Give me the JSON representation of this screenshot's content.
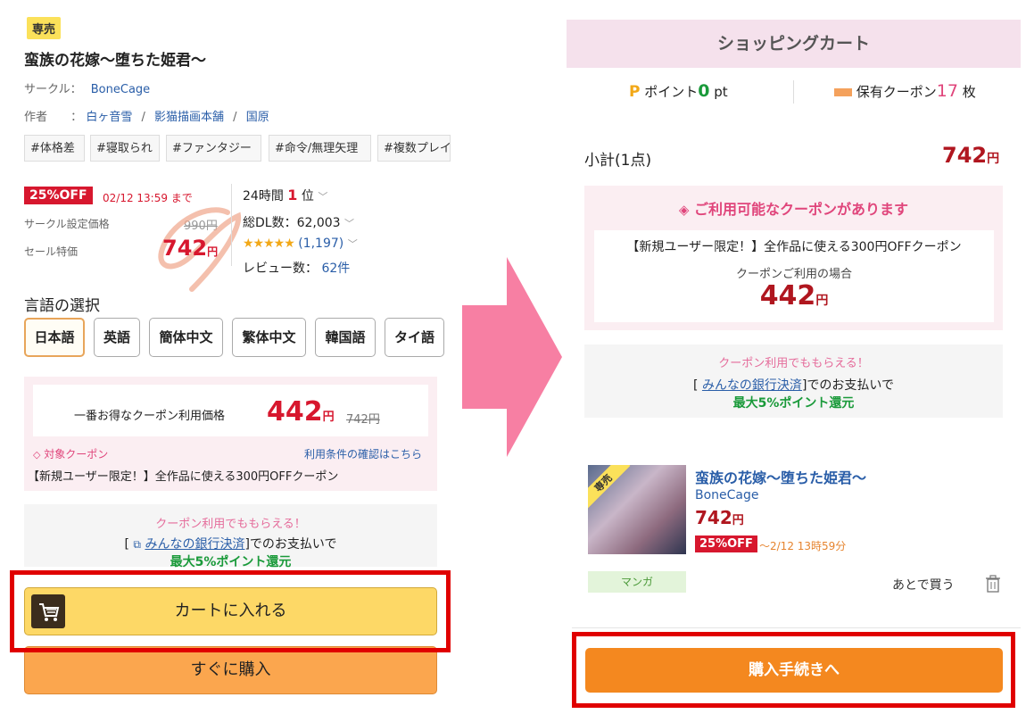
{
  "left": {
    "exclusive_badge": "専売",
    "title": "蛮族の花嫁〜堕ちた姫君〜",
    "circle_label": "サークル：",
    "circle_name": "BoneCage",
    "author_label": "作者",
    "author_sep": "：",
    "authors": [
      "白ヶ音雪",
      "影猫描画本舗",
      "国原"
    ],
    "author_divider": "/",
    "tags": [
      "#体格差",
      "#寝取られ",
      "#ファンタジー",
      "#命令/無理矢理",
      "#複数プレイ"
    ],
    "discount_badge": "25%OFF",
    "deadline": "02/12 13:59 まで",
    "circle_price_label": "サークル設定価格",
    "circle_price": "990円",
    "sale_price_label": "セール特価",
    "sale_price_num": "742",
    "sale_price_unit": "円",
    "rank_prefix": "24時間",
    "rank_num": "1",
    "rank_suffix": "位",
    "total_dl": "総DL数：62,003",
    "rating_stars": "★★★★★",
    "rating_count": "(1,197)",
    "review_label": "レビュー数：",
    "review_count": "62件",
    "chevron": "﹀",
    "language_heading": "言語の選択",
    "languages": [
      "日本語",
      "英語",
      "簡体中文",
      "繁体中文",
      "韓国語",
      "タイ語"
    ],
    "best_coupon_label": "一番お得なクーポン利用価格",
    "best_coupon_price": "442",
    "best_coupon_unit": "円",
    "best_coupon_original": "742円",
    "target_coupon": "対象クーポン",
    "conditions_link": "利用条件の確認はこちら",
    "coupon_name": "【新規ユーザー限定！】全作品に使える300円OFFクーポン",
    "pay_heading": "クーポン利用でももらえる！",
    "pay_bracket_open": "[",
    "pay_link": "みんなの銀行決済",
    "pay_rest": "]でのお支払いで",
    "pay_reward": "最大5%ポイント還元",
    "cart_button": "カートに入れる",
    "buy_button": "すぐに購入"
  },
  "right": {
    "header": "ショッピングカート",
    "point_icon": "P",
    "point_label": "ポイント",
    "point_value": "0",
    "point_unit": "pt",
    "coupon_holding_label": "保有クーポン",
    "coupon_holding_count": "17",
    "coupon_holding_unit": "枚",
    "subtotal_label": "小計(1点)",
    "subtotal_num": "742",
    "subtotal_unit": "円",
    "coupon_available": "ご利用可能なクーポンがあります",
    "coupon_name": "【新規ユーザー限定！】全作品に使える300円OFFクーポン",
    "coupon_use_label": "クーポンご利用の場合",
    "coupon_price_num": "442",
    "coupon_price_unit": "円",
    "pay_heading": "クーポン利用でももらえる！",
    "pay_bracket_open": "[",
    "pay_link": "みんなの銀行決済",
    "pay_rest": "]でのお支払いで",
    "pay_reward": "最大5%ポイント還元",
    "item_badge": "専売",
    "item_title": "蛮族の花嫁〜堕ちた姫君〜",
    "item_circle": "BoneCage",
    "item_price_num": "742",
    "item_price_unit": "円",
    "item_discount": "25%OFF",
    "item_deadline": "〜2/12 13時59分",
    "item_category": "マンガ",
    "later_button": "あとで買う",
    "proceed_button": "購入手続きへ"
  },
  "colors": {
    "accent_red": "#d7172e",
    "cart_yellow": "#fdd866",
    "buy_orange": "#fba64e",
    "proceed_orange": "#f4881f",
    "arrow_pink": "#f77fa3",
    "highlight_frame": "#e00000",
    "reward_green": "#1a9a3a",
    "coupon_pink": "#e0457b"
  }
}
